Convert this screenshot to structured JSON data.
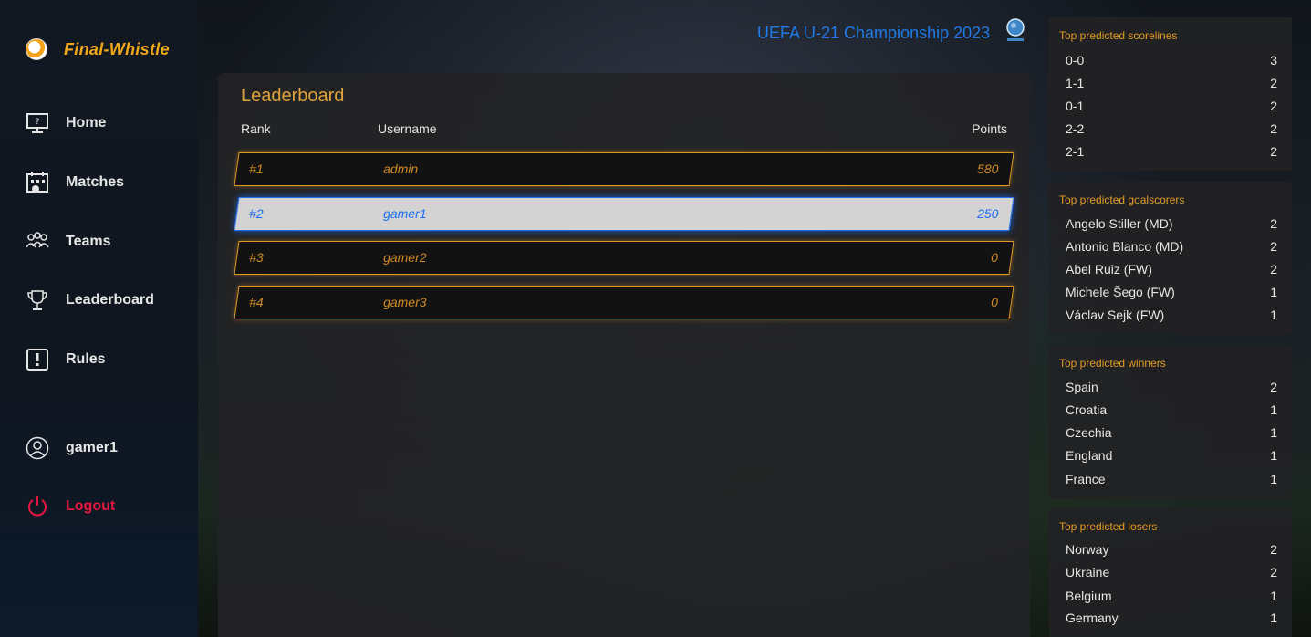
{
  "brand": {
    "name": "Final-Whistle"
  },
  "nav": {
    "home": "Home",
    "matches": "Matches",
    "teams": "Teams",
    "leaderboard": "Leaderboard",
    "rules": "Rules",
    "user": "gamer1",
    "logout": "Logout"
  },
  "header": {
    "title": "UEFA U-21 Championship 2023"
  },
  "leaderboard": {
    "title": "Leaderboard",
    "columns": {
      "rank": "Rank",
      "username": "Username",
      "points": "Points"
    },
    "rows": [
      {
        "rank": "#1",
        "username": "admin",
        "points": "580"
      },
      {
        "rank": "#2",
        "username": "gamer1",
        "points": "250"
      },
      {
        "rank": "#3",
        "username": "gamer2",
        "points": "0"
      },
      {
        "rank": "#4",
        "username": "gamer3",
        "points": "0"
      }
    ]
  },
  "stats": {
    "scorelines": {
      "title": "Top predicted scorelines",
      "items": [
        {
          "label": "0-0",
          "count": "3"
        },
        {
          "label": "1-1",
          "count": "2"
        },
        {
          "label": "0-1",
          "count": "2"
        },
        {
          "label": "2-2",
          "count": "2"
        },
        {
          "label": "2-1",
          "count": "2"
        }
      ]
    },
    "goalscorers": {
      "title": "Top predicted goalscorers",
      "items": [
        {
          "label": "Angelo Stiller (MD)",
          "count": "2"
        },
        {
          "label": "Antonio Blanco (MD)",
          "count": "2"
        },
        {
          "label": "Abel Ruiz (FW)",
          "count": "2"
        },
        {
          "label": "Michele Šego (FW)",
          "count": "1"
        },
        {
          "label": "Václav Sejk (FW)",
          "count": "1"
        }
      ]
    },
    "winners": {
      "title": "Top predicted winners",
      "items": [
        {
          "label": "Spain",
          "count": "2"
        },
        {
          "label": "Croatia",
          "count": "1"
        },
        {
          "label": "Czechia",
          "count": "1"
        },
        {
          "label": "England",
          "count": "1"
        },
        {
          "label": "France",
          "count": "1"
        }
      ]
    },
    "losers": {
      "title": "Top predicted losers",
      "items": [
        {
          "label": "Norway",
          "count": "2"
        },
        {
          "label": "Ukraine",
          "count": "2"
        },
        {
          "label": "Belgium",
          "count": "1"
        },
        {
          "label": "Germany",
          "count": "1"
        }
      ]
    }
  },
  "colors": {
    "accent": "#e39a24",
    "brand_blue": "#1f7ae6",
    "logout_red": "#e3173e",
    "highlight_blue": "#1d6ff2"
  }
}
